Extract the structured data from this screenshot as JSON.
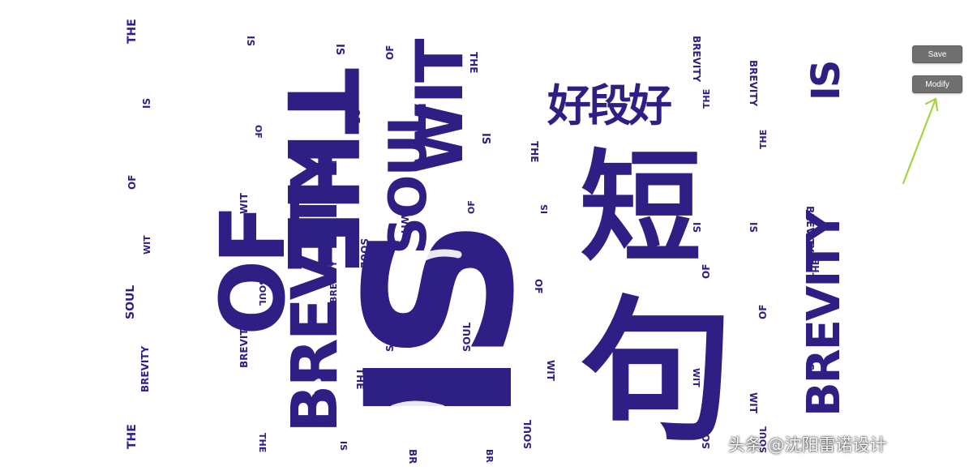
{
  "buttons": {
    "save_label": "Save",
    "modify_label": "Modify"
  },
  "watermark": "头条 @沈阳雷诺设计",
  "artwork": {
    "words": {
      "the": "THE",
      "is": "IS",
      "of": "OF",
      "wit": "WIT",
      "soul": "SOUL",
      "brevity": "BREVITY"
    },
    "chinese_glyphs": {
      "top": "好段好",
      "middle": "短",
      "bottom": "句"
    }
  },
  "colors": {
    "ink": "#2e1f84",
    "button": "#707070",
    "arrow": "#a6d33f"
  }
}
